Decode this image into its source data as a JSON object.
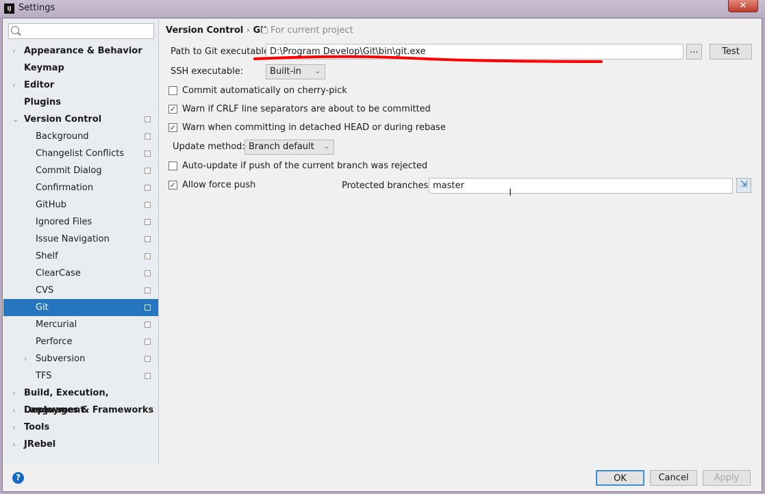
{
  "window": {
    "title": "Settings",
    "close": "✕",
    "app_icon": "IJ"
  },
  "sidebar": {
    "search": {
      "placeholder": "",
      "value": ""
    },
    "items": [
      {
        "label": "Appearance & Behavior",
        "level": 0,
        "arrow": "›"
      },
      {
        "label": "Keymap",
        "level": 0
      },
      {
        "label": "Editor",
        "level": 0,
        "arrow": "›"
      },
      {
        "label": "Plugins",
        "level": 0
      },
      {
        "label": "Version Control",
        "level": 0,
        "arrow": "⌄",
        "copy": true
      },
      {
        "label": "Background",
        "level": 1,
        "copy": true
      },
      {
        "label": "Changelist Conflicts",
        "level": 1,
        "copy": true
      },
      {
        "label": "Commit Dialog",
        "level": 1,
        "copy": true
      },
      {
        "label": "Confirmation",
        "level": 1,
        "copy": true
      },
      {
        "label": "GitHub",
        "level": 1,
        "copy": true
      },
      {
        "label": "Ignored Files",
        "level": 1,
        "copy": true
      },
      {
        "label": "Issue Navigation",
        "level": 1,
        "copy": true
      },
      {
        "label": "Shelf",
        "level": 1,
        "copy": true
      },
      {
        "label": "ClearCase",
        "level": 1,
        "copy": true
      },
      {
        "label": "CVS",
        "level": 1,
        "copy": true
      },
      {
        "label": "Git",
        "level": 1,
        "copy": true,
        "selected": true
      },
      {
        "label": "Mercurial",
        "level": 1,
        "copy": true
      },
      {
        "label": "Perforce",
        "level": 1,
        "copy": true
      },
      {
        "label": "Subversion",
        "level": 1,
        "arrow": "›",
        "copy": true
      },
      {
        "label": "TFS",
        "level": 1,
        "copy": true
      },
      {
        "label": "Build, Execution, Deployment",
        "level": 0,
        "arrow": "›"
      },
      {
        "label": "Languages & Frameworks",
        "level": 0,
        "arrow": "›"
      },
      {
        "label": "Tools",
        "level": 0,
        "arrow": "›"
      },
      {
        "label": "JRebel",
        "level": 0,
        "arrow": "›"
      }
    ]
  },
  "main": {
    "breadcrumb": {
      "parent": "Version Control",
      "sep": "›",
      "current": "Git",
      "scope": "For current project"
    },
    "git_path": {
      "label": "Path to Git executable:",
      "value": "D:\\Program Develop\\Git\\bin\\git.exe",
      "browse": "...",
      "test": "Test"
    },
    "ssh": {
      "label": "SSH executable:",
      "value": "Built-in"
    },
    "checks": [
      {
        "label": "Commit automatically on cherry-pick",
        "checked": false
      },
      {
        "label": "Warn if CRLF line separators are about to be committed",
        "checked": true
      },
      {
        "label": "Warn when committing in detached HEAD or during rebase",
        "checked": true
      }
    ],
    "update_method": {
      "label": "Update method:",
      "value": "Branch default"
    },
    "auto_update": {
      "label": "Auto-update if push of the current branch was rejected",
      "checked": false
    },
    "force_push": {
      "label": "Allow force push",
      "checked": true
    },
    "protected": {
      "label": "Protected branches:",
      "value": "master"
    },
    "annotation_color": "#ff0000"
  },
  "footer": {
    "help": "?",
    "ok": "OK",
    "cancel": "Cancel",
    "apply": "Apply"
  }
}
